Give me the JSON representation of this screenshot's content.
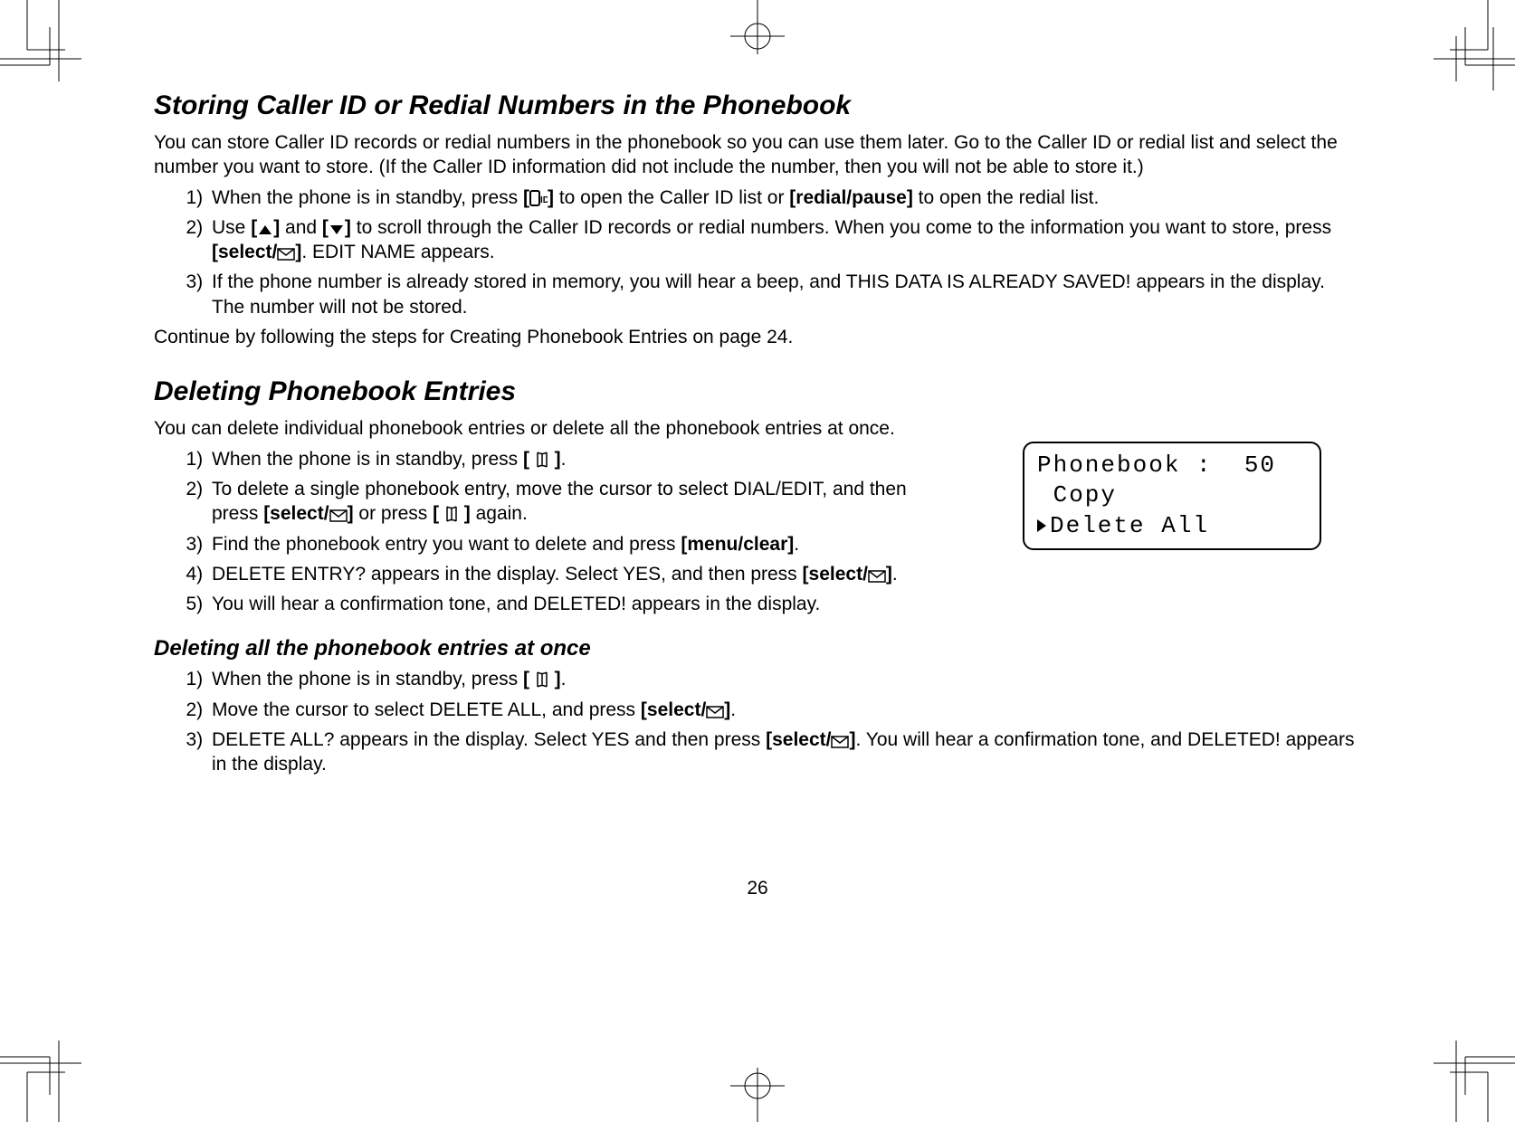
{
  "pagenum": "26",
  "sections": {
    "s1": {
      "title": "Storing Caller ID or Redial Numbers in the Phonebook",
      "intro": "You can store Caller ID records or redial numbers in the phonebook so you can use them later. Go to the Caller ID or redial list and select the number you want to store. (If the Caller ID information did not include the number, then you will not be able to store it.)",
      "l1a": "When the phone is in standby, press ",
      "l1_btn1": "[",
      "l1_btn1b": "]",
      "l1b": " to open the Caller ID list or ",
      "l1_btn2": "[redial/pause]",
      "l1c": " to open the redial list.",
      "l2a": "Use ",
      "l2_up": "[",
      "l2_up_b": "]",
      "l2and": " and ",
      "l2_dn": "[",
      "l2_dn_b": "]",
      "l2b": "  to scroll through the Caller ID records or redial numbers. When you come to the information you want to store, press ",
      "l2_btn": "[select/",
      "l2_btn_b": "]",
      "l2c": ". EDIT NAME appears.",
      "l3": "If the phone number is already stored in memory, you will hear a beep, and THIS DATA IS ALREADY SAVED! appears in the display. The number will not be stored.",
      "outro": "Continue by following the steps for Creating Phonebook Entries on page 24."
    },
    "s2": {
      "title": "Deleting Phonebook Entries",
      "intro": "You can delete individual phonebook entries or delete all the phonebook entries at once.",
      "l1a": "When the phone is in standby, press ",
      "l1_btn": "[ ",
      "l1_btn_b": " ]",
      "l1c": ".",
      "l2a": "To delete a single phonebook entry, move the cursor to select DIAL/EDIT, and then press ",
      "l2_btn1": "[select/",
      "l2_btn1_b": "]",
      "l2b": " or press ",
      "l2_btn2": "[ ",
      "l2_btn2_b": " ]",
      "l2c": " again.",
      "l3a": "Find the phonebook entry you want to delete and press ",
      "l3_btn": "[menu/clear]",
      "l3c": ".",
      "l4a": "DELETE ENTRY? appears in the display. Select YES, and then press ",
      "l4_btn": "[select/",
      "l4_btn_b": "]",
      "l4c": ".",
      "l5": "You will hear a confirmation tone, and DELETED! appears in the display."
    },
    "s3": {
      "title": "Deleting all the phonebook entries at once",
      "l1a": "When the phone is in standby, press ",
      "l1_btn": "[ ",
      "l1_btn_b": " ]",
      "l1c": ".",
      "l2a": "Move the cursor to select DELETE ALL, and press ",
      "l2_btn": "[select/",
      "l2_btn_b": "]",
      "l2c": ".",
      "l3a": "DELETE ALL? appears in the display. Select YES and then press ",
      "l3_btn": "[select/",
      "l3_btn_b": "]",
      "l3c": ". You will hear a confirmation tone, and DELETED! appears in the display."
    }
  },
  "lcd": {
    "line1": "Phonebook :  50",
    "line2": " Copy",
    "line3": "Delete All"
  }
}
